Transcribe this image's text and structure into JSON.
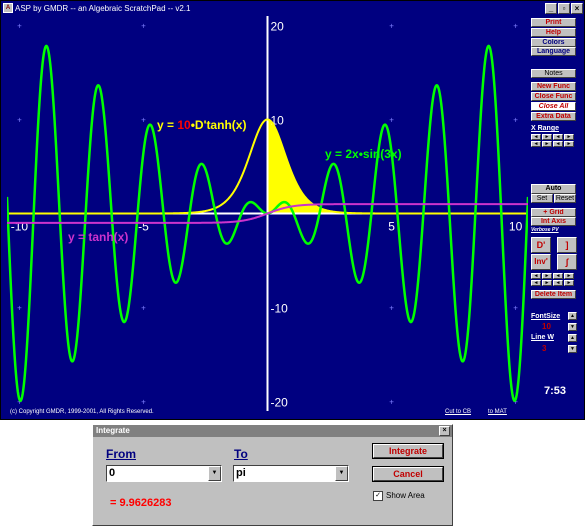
{
  "window": {
    "title": "ASP by GMDR    --    an Algebraic ScratchPad    --    v2.1",
    "buttons": [
      "_",
      "▫",
      "×"
    ]
  },
  "plot": {
    "x_ticks": [
      "-10",
      "-5",
      "5",
      "10"
    ],
    "y_ticks": [
      "20",
      "10",
      "-10",
      "-20"
    ],
    "xlim": [
      -10.5,
      10.5
    ],
    "ylim": [
      -21,
      21
    ],
    "functions": [
      {
        "label_parts": [
          "y = ",
          "10",
          "•D'tanh(x)"
        ],
        "color": "#ffff00",
        "coef_color": "#ff0000",
        "expr": "10*sech^2(x)",
        "filled_area": {
          "from": 0,
          "to": 3.14159
        }
      },
      {
        "label_parts": [
          "y = 2x•sin(3x)"
        ],
        "color": "#00ff00",
        "expr": "2x*sin(3x)"
      },
      {
        "label_parts": [
          "y = tanh(x)"
        ],
        "color": "#cc33cc",
        "expr": "tanh(x)"
      }
    ]
  },
  "footer": {
    "copyright": "(c) Copyright GMDR, 1999-2001, All Rights Reserved.",
    "cut_to_cb": "Cut to CB",
    "to_mat": "to MAT"
  },
  "panel": {
    "print": "Print",
    "help": "Help",
    "colors": "Colors",
    "language": "Language",
    "notes": "Notes",
    "new_func": "New Func",
    "close_func": "Close Func",
    "close_all": "Close All",
    "extra_data": "Extra Data",
    "x_range": "X Range",
    "auto": "Auto",
    "set": "Set",
    "reset": "Reset",
    "grid": "+ Grid",
    "int_axis": "Int Axis",
    "verbose": "Verbose PV",
    "d_prime": "D'",
    "bracket": "]",
    "inv_prime": "Inv'",
    "integral": "∫",
    "delete_item": "Delete Item",
    "font_size_label": "FontSize",
    "font_size_value": "10",
    "line_w_label": "Line W",
    "line_w_value": "3",
    "clock": "7:53"
  },
  "dialog": {
    "title": "Integrate",
    "close": "×",
    "from_label": "From",
    "from_value": "0",
    "to_label": "To",
    "to_value": "pi",
    "result": "= 9.9626283",
    "integrate_button": "Integrate",
    "cancel_button": "Cancel",
    "show_area_label": "Show Area",
    "show_area_checked": true
  }
}
